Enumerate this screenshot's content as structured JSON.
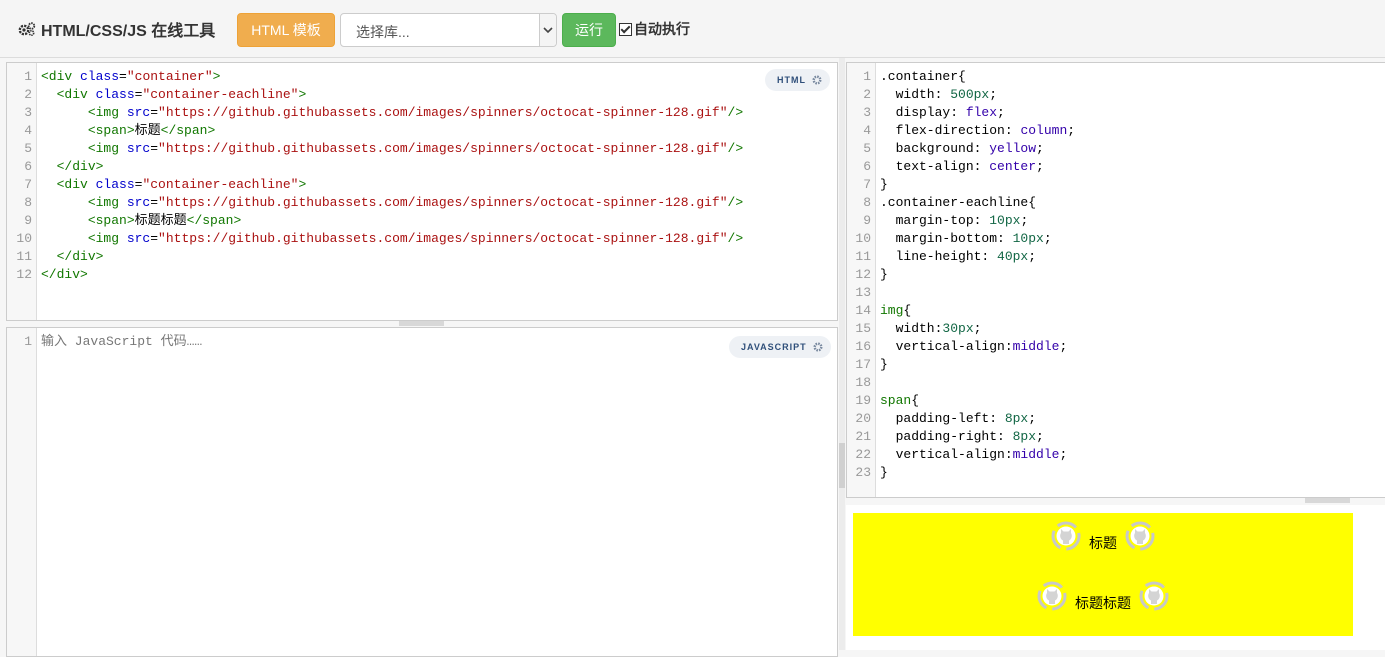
{
  "toolbar": {
    "title": "HTML/CSS/JS 在线工具",
    "template_button": "HTML 模板",
    "library_select": {
      "placeholder": "选择库..."
    },
    "run_button": "运行",
    "auto_run": {
      "label": "自动执行",
      "checked": true
    }
  },
  "html_editor": {
    "badge": "HTML",
    "lines": [
      [
        {
          "c": "t",
          "v": "<div "
        },
        {
          "c": "a",
          "v": "class"
        },
        {
          "c": "",
          "v": "="
        },
        {
          "c": "s",
          "v": "\"container\""
        },
        {
          "c": "t",
          "v": ">"
        }
      ],
      [
        {
          "c": "",
          "v": "  "
        },
        {
          "c": "t",
          "v": "<div "
        },
        {
          "c": "a",
          "v": "class"
        },
        {
          "c": "",
          "v": "="
        },
        {
          "c": "s",
          "v": "\"container-eachline\""
        },
        {
          "c": "t",
          "v": ">"
        }
      ],
      [
        {
          "c": "",
          "v": "      "
        },
        {
          "c": "t",
          "v": "<img "
        },
        {
          "c": "a",
          "v": "src"
        },
        {
          "c": "",
          "v": "="
        },
        {
          "c": "s",
          "v": "\"https://github.githubassets.com/images/spinners/octocat-spinner-128.gif\""
        },
        {
          "c": "t",
          "v": "/>"
        }
      ],
      [
        {
          "c": "",
          "v": "      "
        },
        {
          "c": "t",
          "v": "<span>"
        },
        {
          "c": "",
          "v": "标题"
        },
        {
          "c": "t",
          "v": "</span>"
        }
      ],
      [
        {
          "c": "",
          "v": "      "
        },
        {
          "c": "t",
          "v": "<img "
        },
        {
          "c": "a",
          "v": "src"
        },
        {
          "c": "",
          "v": "="
        },
        {
          "c": "s",
          "v": "\"https://github.githubassets.com/images/spinners/octocat-spinner-128.gif\""
        },
        {
          "c": "t",
          "v": "/>"
        }
      ],
      [
        {
          "c": "",
          "v": "  "
        },
        {
          "c": "t",
          "v": "</div>"
        }
      ],
      [
        {
          "c": "",
          "v": "  "
        },
        {
          "c": "t",
          "v": "<div "
        },
        {
          "c": "a",
          "v": "class"
        },
        {
          "c": "",
          "v": "="
        },
        {
          "c": "s",
          "v": "\"container-eachline\""
        },
        {
          "c": "t",
          "v": ">"
        }
      ],
      [
        {
          "c": "",
          "v": "      "
        },
        {
          "c": "t",
          "v": "<img "
        },
        {
          "c": "a",
          "v": "src"
        },
        {
          "c": "",
          "v": "="
        },
        {
          "c": "s",
          "v": "\"https://github.githubassets.com/images/spinners/octocat-spinner-128.gif\""
        },
        {
          "c": "t",
          "v": "/>"
        }
      ],
      [
        {
          "c": "",
          "v": "      "
        },
        {
          "c": "t",
          "v": "<span>"
        },
        {
          "c": "",
          "v": "标题标题"
        },
        {
          "c": "t",
          "v": "</span>"
        }
      ],
      [
        {
          "c": "",
          "v": "      "
        },
        {
          "c": "t",
          "v": "<img "
        },
        {
          "c": "a",
          "v": "src"
        },
        {
          "c": "",
          "v": "="
        },
        {
          "c": "s",
          "v": "\"https://github.githubassets.com/images/spinners/octocat-spinner-128.gif\""
        },
        {
          "c": "t",
          "v": "/>"
        }
      ],
      [
        {
          "c": "",
          "v": "  "
        },
        {
          "c": "t",
          "v": "</div>"
        }
      ],
      [
        {
          "c": "t",
          "v": "</div>"
        }
      ]
    ]
  },
  "js_editor": {
    "badge": "JAVASCRIPT",
    "placeholder": "输入 JavaScript 代码……"
  },
  "css_editor": {
    "lines": [
      [
        {
          "c": "",
          "v": ".container{"
        }
      ],
      [
        {
          "c": "",
          "v": "  width: "
        },
        {
          "c": "n",
          "v": "500px"
        },
        {
          "c": "",
          "v": ";"
        }
      ],
      [
        {
          "c": "",
          "v": "  display: "
        },
        {
          "c": "k",
          "v": "flex"
        },
        {
          "c": "",
          "v": ";"
        }
      ],
      [
        {
          "c": "",
          "v": "  flex-direction: "
        },
        {
          "c": "k",
          "v": "column"
        },
        {
          "c": "",
          "v": ";"
        }
      ],
      [
        {
          "c": "",
          "v": "  background: "
        },
        {
          "c": "k",
          "v": "yellow"
        },
        {
          "c": "",
          "v": ";"
        }
      ],
      [
        {
          "c": "",
          "v": "  text-align: "
        },
        {
          "c": "k",
          "v": "center"
        },
        {
          "c": "",
          "v": ";"
        }
      ],
      [
        {
          "c": "",
          "v": "}"
        }
      ],
      [
        {
          "c": "",
          "v": ".container-eachline{"
        }
      ],
      [
        {
          "c": "",
          "v": "  margin-top: "
        },
        {
          "c": "n",
          "v": "10px"
        },
        {
          "c": "",
          "v": ";"
        }
      ],
      [
        {
          "c": "",
          "v": "  margin-bottom: "
        },
        {
          "c": "n",
          "v": "10px"
        },
        {
          "c": "",
          "v": ";"
        }
      ],
      [
        {
          "c": "",
          "v": "  line-height: "
        },
        {
          "c": "n",
          "v": "40px"
        },
        {
          "c": "",
          "v": ";"
        }
      ],
      [
        {
          "c": "",
          "v": "}"
        }
      ],
      [
        {
          "c": "",
          "v": ""
        }
      ],
      [
        {
          "c": "t",
          "v": "img"
        },
        {
          "c": "",
          "v": "{"
        }
      ],
      [
        {
          "c": "",
          "v": "  width:"
        },
        {
          "c": "n",
          "v": "30px"
        },
        {
          "c": "",
          "v": ";"
        }
      ],
      [
        {
          "c": "",
          "v": "  vertical-align:"
        },
        {
          "c": "k",
          "v": "middle"
        },
        {
          "c": "",
          "v": ";"
        }
      ],
      [
        {
          "c": "",
          "v": "}"
        }
      ],
      [
        {
          "c": "",
          "v": ""
        }
      ],
      [
        {
          "c": "t",
          "v": "span"
        },
        {
          "c": "",
          "v": "{"
        }
      ],
      [
        {
          "c": "",
          "v": "  padding-left: "
        },
        {
          "c": "n",
          "v": "8px"
        },
        {
          "c": "",
          "v": ";"
        }
      ],
      [
        {
          "c": "",
          "v": "  padding-right: "
        },
        {
          "c": "n",
          "v": "8px"
        },
        {
          "c": "",
          "v": ";"
        }
      ],
      [
        {
          "c": "",
          "v": "  vertical-align:"
        },
        {
          "c": "k",
          "v": "middle"
        },
        {
          "c": "",
          "v": ";"
        }
      ],
      [
        {
          "c": "",
          "v": "}"
        }
      ]
    ]
  },
  "preview": {
    "rows": [
      "标题",
      "标题标题"
    ]
  }
}
